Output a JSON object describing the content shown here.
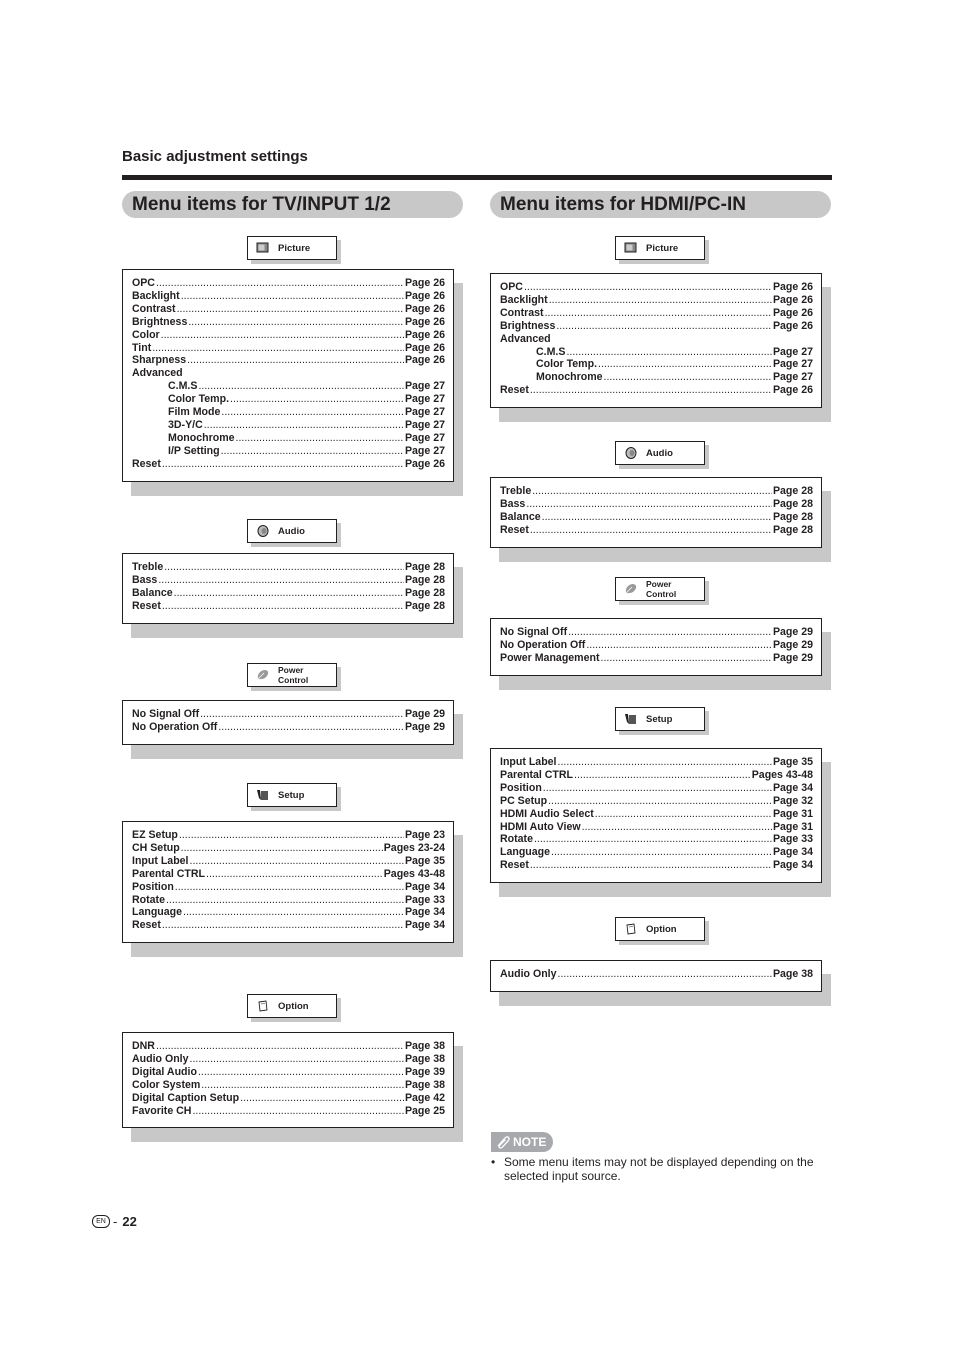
{
  "section_title": "Basic adjustment settings",
  "left": {
    "heading": "Menu items for TV/INPUT 1/2",
    "groups": {
      "picture": {
        "tag": "Picture",
        "icon": "picture-icon",
        "items": [
          {
            "label": "OPC",
            "page": "Page 26"
          },
          {
            "label": "Backlight",
            "page": "Page 26"
          },
          {
            "label": "Contrast",
            "page": "Page 26"
          },
          {
            "label": "Brightness",
            "page": "Page 26"
          },
          {
            "label": "Color",
            "page": "Page 26"
          },
          {
            "label": "Tint",
            "page": "Page 26"
          },
          {
            "label": "Sharpness",
            "page": "Page 26"
          },
          {
            "label": "Advanced",
            "page": ""
          },
          {
            "label": "C.M.S",
            "page": "Page 27",
            "indent": true
          },
          {
            "label": "Color Temp.",
            "page": "Page 27",
            "indent": true
          },
          {
            "label": "Film Mode",
            "page": "Page 27",
            "indent": true
          },
          {
            "label": "3D-Y/C",
            "page": "Page 27",
            "indent": true
          },
          {
            "label": "Monochrome",
            "page": "Page 27",
            "indent": true
          },
          {
            "label": "I/P Setting",
            "page": "Page 27",
            "indent": true
          },
          {
            "label": "Reset",
            "page": "Page 26"
          }
        ]
      },
      "audio": {
        "tag": "Audio",
        "icon": "speaker-icon",
        "items": [
          {
            "label": "Treble",
            "page": "Page 28"
          },
          {
            "label": "Bass",
            "page": "Page 28"
          },
          {
            "label": "Balance",
            "page": "Page 28"
          },
          {
            "label": "Reset",
            "page": "Page 28"
          }
        ]
      },
      "power": {
        "tag": "Power Control",
        "icon": "power-leaf-icon",
        "items": [
          {
            "label": "No Signal Off",
            "page": "Page 29"
          },
          {
            "label": "No Operation Off",
            "page": "Page 29"
          }
        ]
      },
      "setup": {
        "tag": "Setup",
        "icon": "setup-icon",
        "items": [
          {
            "label": "EZ Setup",
            "page": "Page 23"
          },
          {
            "label": "CH Setup",
            "page": "Pages 23-24"
          },
          {
            "label": "Input Label",
            "page": "Page 35"
          },
          {
            "label": "Parental CTRL",
            "page": "Pages 43-48"
          },
          {
            "label": "Position",
            "page": "Page 34"
          },
          {
            "label": "Rotate",
            "page": "Page 33"
          },
          {
            "label": "Language",
            "page": "Page 34"
          },
          {
            "label": "Reset",
            "page": "Page 34"
          }
        ]
      },
      "option": {
        "tag": "Option",
        "icon": "option-icon",
        "items": [
          {
            "label": "DNR",
            "page": "Page 38"
          },
          {
            "label": "Audio Only",
            "page": "Page 38"
          },
          {
            "label": "Digital Audio",
            "page": "Page 39"
          },
          {
            "label": "Color System",
            "page": "Page 38"
          },
          {
            "label": "Digital Caption Setup",
            "page": "Page 42"
          },
          {
            "label": "Favorite CH",
            "page": "Page 25"
          }
        ]
      }
    }
  },
  "right": {
    "heading": "Menu items for HDMI/PC-IN",
    "groups": {
      "picture": {
        "tag": "Picture",
        "icon": "picture-icon",
        "items": [
          {
            "label": "OPC",
            "page": "Page 26"
          },
          {
            "label": "Backlight",
            "page": "Page 26"
          },
          {
            "label": "Contrast",
            "page": "Page 26"
          },
          {
            "label": "Brightness",
            "page": "Page 26"
          },
          {
            "label": "Advanced",
            "page": ""
          },
          {
            "label": "C.M.S",
            "page": "Page 27",
            "indent": true
          },
          {
            "label": "Color Temp.",
            "page": "Page 27",
            "indent": true
          },
          {
            "label": "Monochrome",
            "page": "Page 27",
            "indent": true
          },
          {
            "label": "Reset",
            "page": "Page 26"
          }
        ]
      },
      "audio": {
        "tag": "Audio",
        "icon": "speaker-icon",
        "items": [
          {
            "label": "Treble",
            "page": "Page 28"
          },
          {
            "label": "Bass",
            "page": "Page 28"
          },
          {
            "label": "Balance",
            "page": "Page 28"
          },
          {
            "label": "Reset",
            "page": "Page 28"
          }
        ]
      },
      "power": {
        "tag": "Power Control",
        "icon": "power-leaf-icon",
        "items": [
          {
            "label": "No Signal Off",
            "page": "Page 29"
          },
          {
            "label": "No Operation Off",
            "page": "Page 29"
          },
          {
            "label": "Power Management",
            "page": "Page 29"
          }
        ]
      },
      "setup": {
        "tag": "Setup",
        "icon": "setup-icon",
        "items": [
          {
            "label": "Input Label",
            "page": "Page 35"
          },
          {
            "label": "Parental CTRL",
            "page": "Pages 43-48"
          },
          {
            "label": "Position",
            "page": "Page 34"
          },
          {
            "label": "PC Setup",
            "page": "Page 32"
          },
          {
            "label": "HDMI Audio Select",
            "page": "Page 31"
          },
          {
            "label": "HDMI Auto View",
            "page": "Page 31"
          },
          {
            "label": "Rotate",
            "page": "Page 33"
          },
          {
            "label": "Language",
            "page": "Page 34"
          },
          {
            "label": "Reset",
            "page": "Page 34"
          }
        ]
      },
      "option": {
        "tag": "Option",
        "icon": "option-icon",
        "items": [
          {
            "label": "Audio Only",
            "page": "Page 38"
          }
        ]
      }
    }
  },
  "note": {
    "badge": "NOTE",
    "bullet": "•",
    "text": "Some menu items may not be displayed depending on the selected input source."
  },
  "footer": {
    "lang_badge": "EN",
    "separator": "-",
    "page_number": "22"
  }
}
